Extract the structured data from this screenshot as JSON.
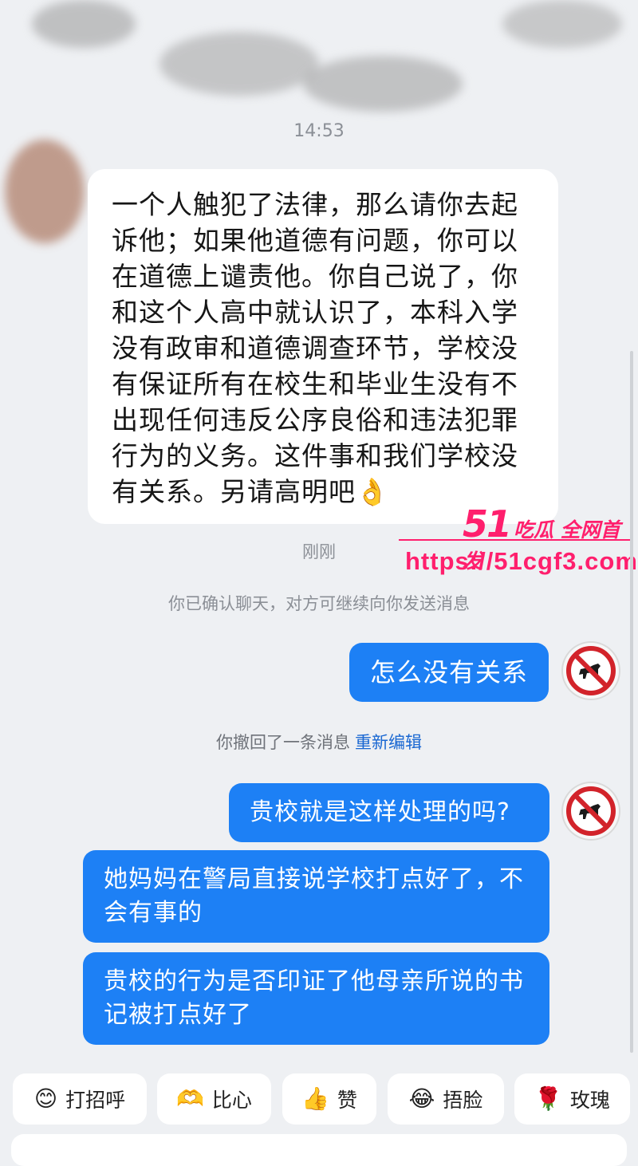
{
  "chat": {
    "time_label": "14:53",
    "incoming_message": "一个人触犯了法律，那么请你去起诉他；如果他道德有问题，你可以在道德上谴责他。你自己说了，你和这个人高中就认识了，本科入学没有政审和道德调查环节，学校没有保证所有在校生和毕业生没有不出现任何违反公序良俗和违法犯罪行为的义务。这件事和我们学校没有关系。另请高明吧",
    "incoming_emoji": "👌",
    "just_now_label": "刚刚",
    "confirm_notice": "你已确认聊天，对方可继续向你发送消息",
    "outgoing_1": "怎么没有关系",
    "recall_notice": "你撤回了一条消息",
    "recall_reedit": "重新编辑",
    "outgoing_2": "贵校就是这样处理的吗?",
    "outgoing_3": "她妈妈在警局直接说学校打点好了，不会有事的",
    "outgoing_4": "贵校的行为是否印证了他母亲所说的书记被打点好了"
  },
  "watermark": {
    "brand_number": "51",
    "brand_text": "吃瓜 全网首发",
    "url": "https://51cgf3.com"
  },
  "quick_replies": [
    {
      "icon": "😊",
      "label": "打招呼"
    },
    {
      "icon": "🫶",
      "label": "比心"
    },
    {
      "icon": "👍",
      "label": "赞"
    },
    {
      "icon": "😂",
      "label": "捂脸"
    },
    {
      "icon": "🌹",
      "label": "玫瑰"
    }
  ],
  "colors": {
    "background": "#eef0f3",
    "outgoing_bubble": "#1d80f5",
    "link": "#1967d2",
    "watermark": "#ff1f6d"
  }
}
